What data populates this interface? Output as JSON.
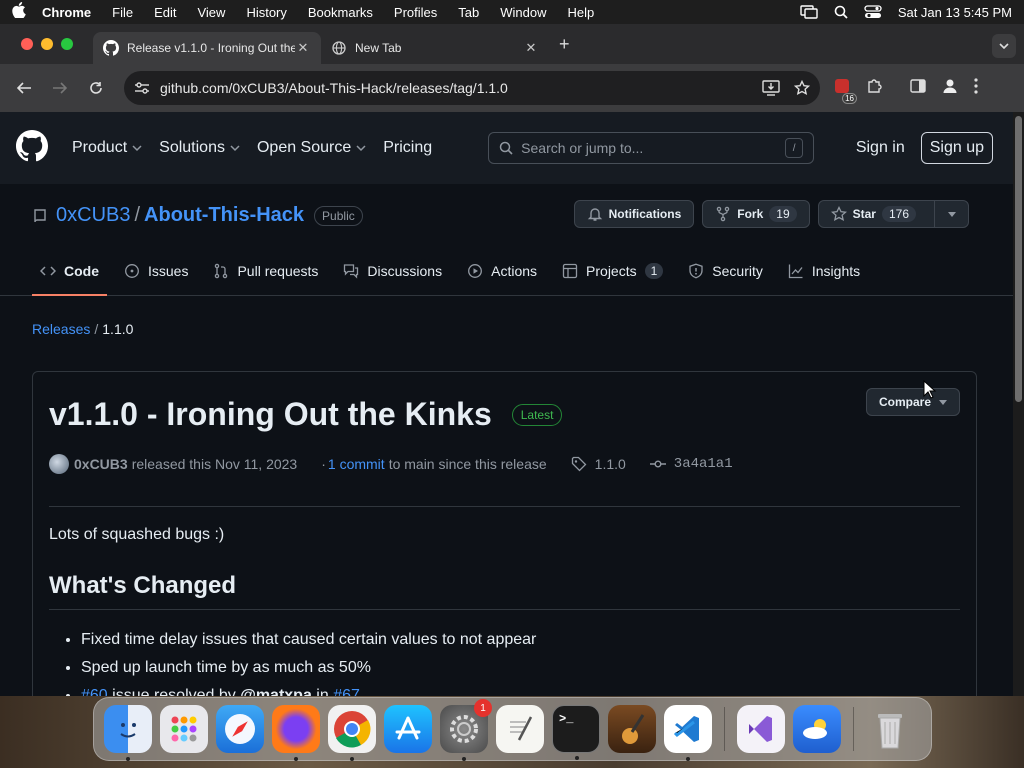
{
  "menubar": {
    "app": "Chrome",
    "items": [
      "File",
      "Edit",
      "View",
      "History",
      "Bookmarks",
      "Profiles",
      "Tab",
      "Window",
      "Help"
    ],
    "datetime": "Sat Jan 13  5:45 PM"
  },
  "browser": {
    "tabs": [
      {
        "title": "Release v1.1.0 - Ironing Out the Kinks",
        "active": true
      },
      {
        "title": "New Tab",
        "active": false
      }
    ],
    "url": "github.com/0xCUB3/About-This-Hack/releases/tag/1.1.0",
    "extension_badge": "16"
  },
  "github": {
    "nav": [
      "Product",
      "Solutions",
      "Open Source",
      "Pricing"
    ],
    "search_placeholder": "Search or jump to...",
    "search_key": "/",
    "sign_in": "Sign in",
    "sign_up": "Sign up"
  },
  "repo": {
    "owner": "0xCUB3",
    "slash": "/",
    "name": "About-This-Hack",
    "visibility": "Public",
    "notifications": "Notifications",
    "fork_label": "Fork",
    "fork_count": "19",
    "star_label": "Star",
    "star_count": "176",
    "tabs": [
      {
        "label": "Code"
      },
      {
        "label": "Issues"
      },
      {
        "label": "Pull requests"
      },
      {
        "label": "Discussions"
      },
      {
        "label": "Actions"
      },
      {
        "label": "Projects",
        "count": "1"
      },
      {
        "label": "Security"
      },
      {
        "label": "Insights"
      }
    ]
  },
  "breadcrumb": {
    "root": "Releases",
    "sep": "/",
    "current": "1.1.0"
  },
  "release": {
    "title": "v1.1.0 - Ironing Out the Kinks",
    "badge": "Latest",
    "compare": "Compare",
    "author": "0xCUB3",
    "released_text": "released this Nov 11, 2023",
    "commit_prefix": "·",
    "commit_link": "1 commit",
    "commit_suffix": "to main since this release",
    "tag": "1.1.0",
    "sha": "3a4a1a1",
    "body": "Lots of squashed bugs :)",
    "heading": "What's Changed",
    "changes": [
      "Fixed time delay issues that caused certain values to not appear",
      "Sped up launch time by as much as 50%"
    ],
    "partial_item": {
      "issue": "#60",
      "mid": " issue resolved by ",
      "user": "@matxpa",
      "in": " in ",
      "pr": "#67"
    }
  },
  "dock": {
    "settings_badge": "1",
    "apps": [
      "finder-icon",
      "launchpad-icon",
      "safari-icon",
      "firefox-icon",
      "chrome-icon",
      "app-store-icon",
      "system-settings-icon",
      "textedit-icon",
      "terminal-icon",
      "garageband-icon",
      "vscode-icon",
      "visual-studio-icon",
      "weather-icon",
      "trash-icon"
    ]
  }
}
